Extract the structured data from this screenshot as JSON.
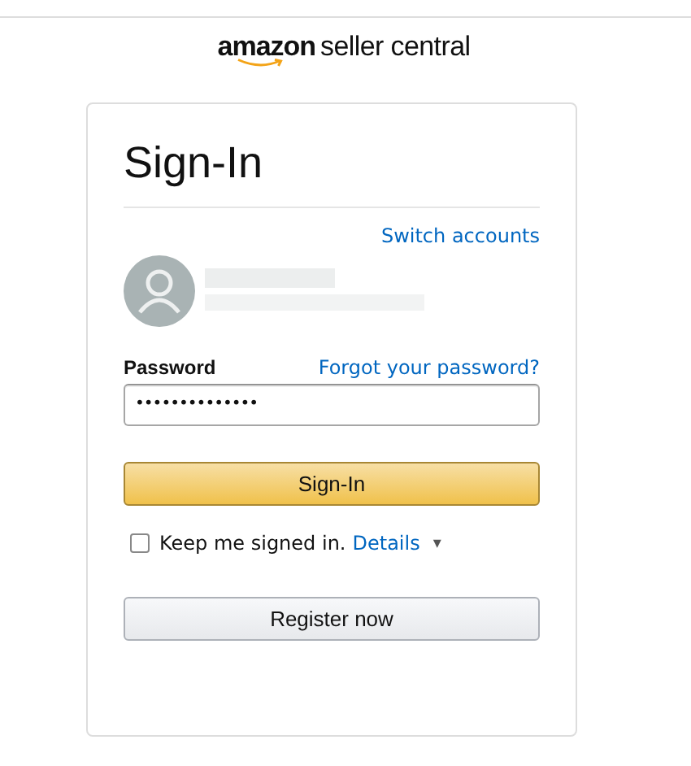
{
  "logo": {
    "brand": "amazon",
    "product": "seller central"
  },
  "title": "Sign-In",
  "switch_link": "Switch accounts",
  "password": {
    "label": "Password",
    "forgot_link": "Forgot your password?",
    "value": "••••••••••••••"
  },
  "sign_in_button": "Sign-In",
  "keep_signed_in": {
    "label": "Keep me signed in.",
    "checked": false,
    "details_link": "Details",
    "caret": "▾"
  },
  "register_button": "Register now"
}
